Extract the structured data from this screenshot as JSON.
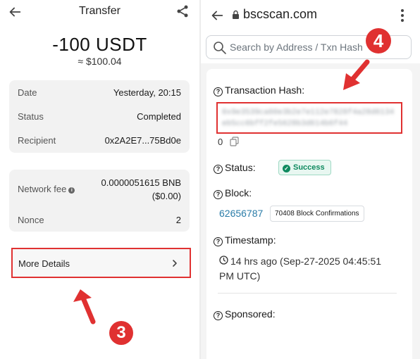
{
  "wallet": {
    "header_title": "Transfer",
    "amount": "-100 USDT",
    "amount_usd": "≈ $100.04",
    "details": [
      {
        "key": "Date",
        "value": "Yesterday, 20:15"
      },
      {
        "key": "Status",
        "value": "Completed"
      },
      {
        "key": "Recipient",
        "value": "0x2A2E7...75Bd0e"
      }
    ],
    "fee": {
      "key": "Network fee",
      "value_line1": "0.0000051615 BNB",
      "value_line2": "($0.00)"
    },
    "nonce": {
      "key": "Nonce",
      "value": "2"
    },
    "more_details_label": "More Details",
    "step_badge": "3"
  },
  "browser": {
    "url": "bscscan.com",
    "search_placeholder": "Search by Address / Txn Hash",
    "step_badge": "4",
    "tx": {
      "hash_label": "Transaction Hash:",
      "hash_value": "0x9e3539ca60e3b2e7e112e7828f4a28d6134eb5cc6bff2fe5628b3d614b6f44",
      "copy_count": "0",
      "status_label": "Status:",
      "status_value": "Success",
      "block_label": "Block:",
      "block_number": "62656787",
      "block_confirmations": "70408 Block Confirmations",
      "timestamp_label": "Timestamp:",
      "timestamp_value": "14 hrs ago (Sep-27-2025 04:45:51 PM UTC)",
      "sponsored_label": "Sponsored:"
    }
  },
  "colors": {
    "highlight_red": "#e03131",
    "success_green": "#0f8a5f",
    "link_blue": "#2a7ca8"
  }
}
